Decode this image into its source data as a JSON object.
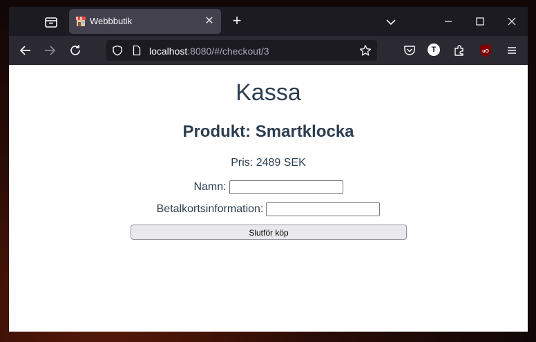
{
  "browser": {
    "tab": {
      "title": "Webbbutik"
    },
    "url": {
      "host": "localhost",
      "rest": ":8080/#/checkout/3"
    }
  },
  "page": {
    "heading": "Kassa",
    "product_title": "Produkt: Smartklocka",
    "price": "Pris: 2489 SEK",
    "form": {
      "name_label": "Namn:",
      "name_value": "",
      "card_label": "Betalkortsinformation:",
      "card_value": "",
      "submit_label": "Slutför köp"
    }
  },
  "icons": {
    "tab_list": "tab-list-icon",
    "favicon": "shop-favicon-icon",
    "tab_close": "close-icon",
    "new_tab": "plus-icon",
    "list_all_tabs": "chevron-down-icon",
    "minimize": "minimize-icon",
    "maximize": "maximize-icon",
    "close_window": "close-icon",
    "back": "back-arrow-icon",
    "forward": "forward-arrow-icon",
    "reload": "reload-icon",
    "shield": "shield-icon",
    "page": "page-icon",
    "bookmark": "star-icon",
    "pocket": "pocket-icon",
    "account": "account-icon",
    "extensions": "puzzle-icon",
    "ublock": "ublock-icon",
    "menu": "hamburger-menu-icon"
  }
}
